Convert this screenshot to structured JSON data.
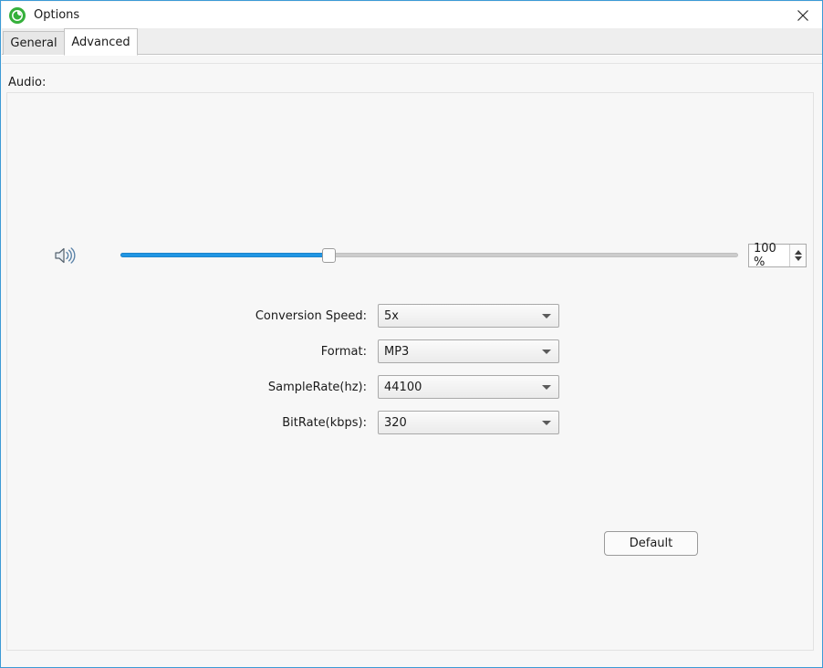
{
  "window": {
    "title": "Options",
    "app_icon": "app-logo-icon",
    "accent_color": "#3c9ad6",
    "close_label": "✕"
  },
  "tabs": [
    {
      "label": "General",
      "active": false
    },
    {
      "label": "Advanced",
      "active": true
    }
  ],
  "content": {
    "group_label": "Audio:",
    "volume": {
      "icon": "speaker-volume-icon",
      "value": 100,
      "display_value": "100 %",
      "slider_percent": 33,
      "fill_color": "#2196e3",
      "track_color": "#cccccc"
    },
    "fields": [
      {
        "label": "Conversion Speed:",
        "value": "5x",
        "name": "conversion-speed"
      },
      {
        "label": "Format:",
        "value": "MP3",
        "name": "format"
      },
      {
        "label": "SampleRate(hz):",
        "value": "44100",
        "name": "sample-rate"
      },
      {
        "label": "BitRate(kbps):",
        "value": "320",
        "name": "bit-rate"
      }
    ],
    "default_button": "Default"
  }
}
